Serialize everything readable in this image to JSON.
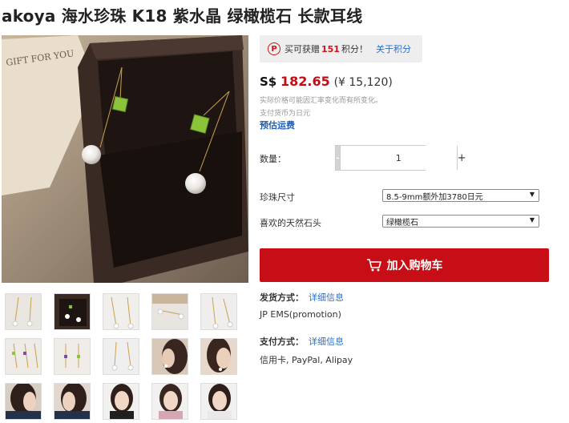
{
  "product": {
    "title": "akoya 海水珍珠 K18 紫水晶 绿橄榄石 长款耳线"
  },
  "points": {
    "badge": "P",
    "prefix": "买可获赠",
    "number": "151",
    "suffix": "积分！",
    "link": "关于积分"
  },
  "price": {
    "currency": "S$",
    "value": "182.65",
    "alt": "(¥ 15,120)"
  },
  "notes": {
    "rate_note": "实际价格可能因汇率变化而有所变化。",
    "pay_currency": "支付货币为日元"
  },
  "shipping_estimate_link": "预估运费",
  "quantity": {
    "label": "数量：",
    "minus": "-",
    "value": "1",
    "plus": "+"
  },
  "options": [
    {
      "label": "珍珠尺寸",
      "selected": "8.5-9mm额外加3780日元"
    },
    {
      "label": "喜欢的天然石头",
      "selected": "绿橄榄石"
    }
  ],
  "cart_button": {
    "label": "加入购物车",
    "icon": "cart-icon"
  },
  "delivery": {
    "label": "发货方式：",
    "link": "详细信息",
    "value": "JP EMS(promotion)"
  },
  "payment": {
    "label": "支付方式：",
    "link": "详细信息",
    "value": "信用卡, PayPal, Alipay"
  },
  "main_image": {
    "box_lettering": "GIFT FOR YOU"
  },
  "colors": {
    "accent_red": "#c70d15",
    "link_blue": "#2a6fc9",
    "peridot_green": "#8bc43a"
  }
}
